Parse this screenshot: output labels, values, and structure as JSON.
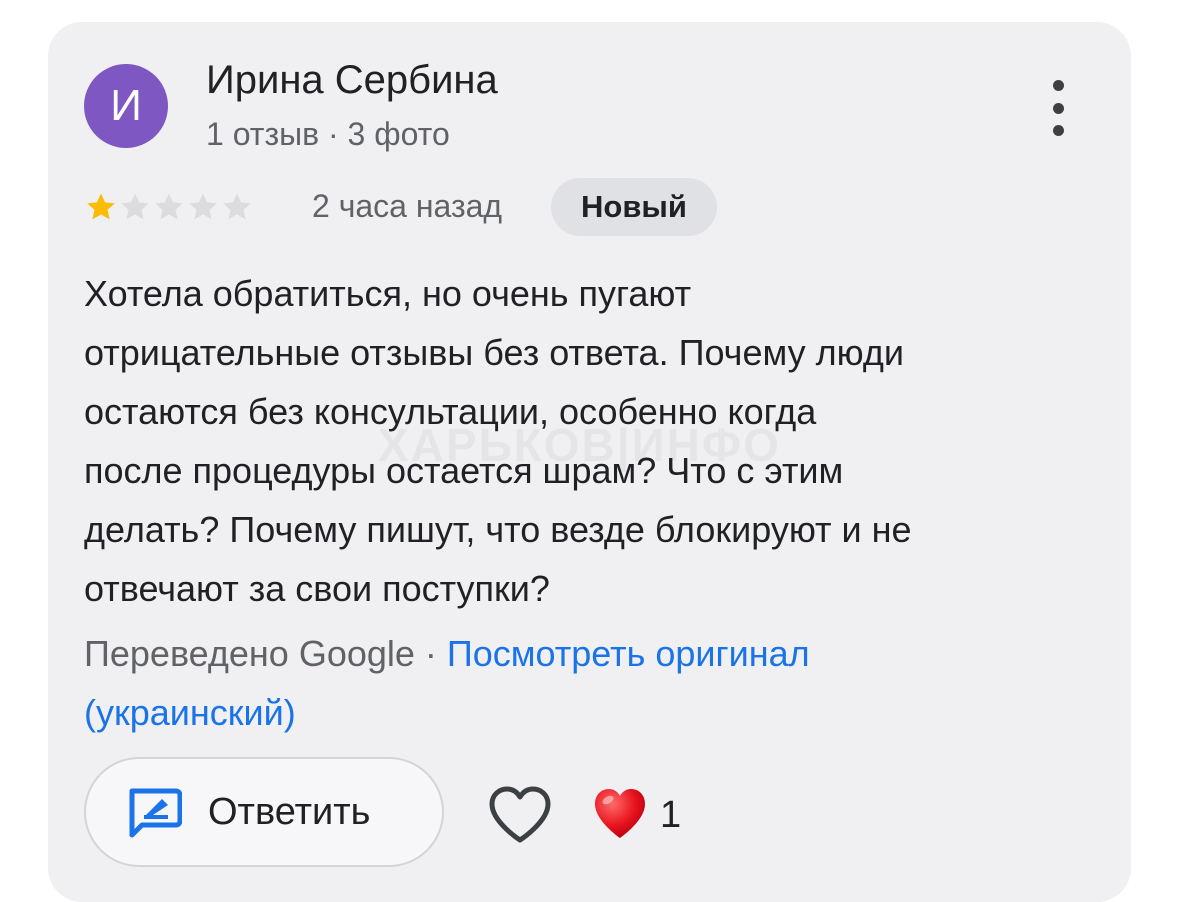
{
  "review": {
    "author": {
      "initial": "И",
      "name": "Ирина Сербина",
      "meta": "1 отзыв · 3 фото",
      "avatar_color": "#7e57c2"
    },
    "rating": {
      "value": 1,
      "max": 5,
      "filled_color": "#fbbc04",
      "empty_color": "#dadce0"
    },
    "time": "2 часа назад",
    "badge": "Новый",
    "text_lines": [
      "Хотела обратиться, но очень пугают",
      "отрицательные отзывы без ответа. Почему люди",
      "остаются без консультации, особенно когда",
      "после процедуры остается шрам? Что с этим",
      "делать? Почему пишут, что везде блокируют и не",
      "отвечают за свои поступки?"
    ],
    "translation": {
      "prefix": "Переведено Google · ",
      "link_line1": "Посмотреть оригинал",
      "link_line2": "(украинский)",
      "link_color": "#1a73e8"
    }
  },
  "actions": {
    "reply_label": "Ответить",
    "reply_icon": "reply-edit-icon",
    "like_icon": "heart-outline-icon",
    "reaction_icon": "red-heart-icon",
    "reaction_count": "1"
  },
  "watermark": "ХАРЬКОВ|ИНФО"
}
